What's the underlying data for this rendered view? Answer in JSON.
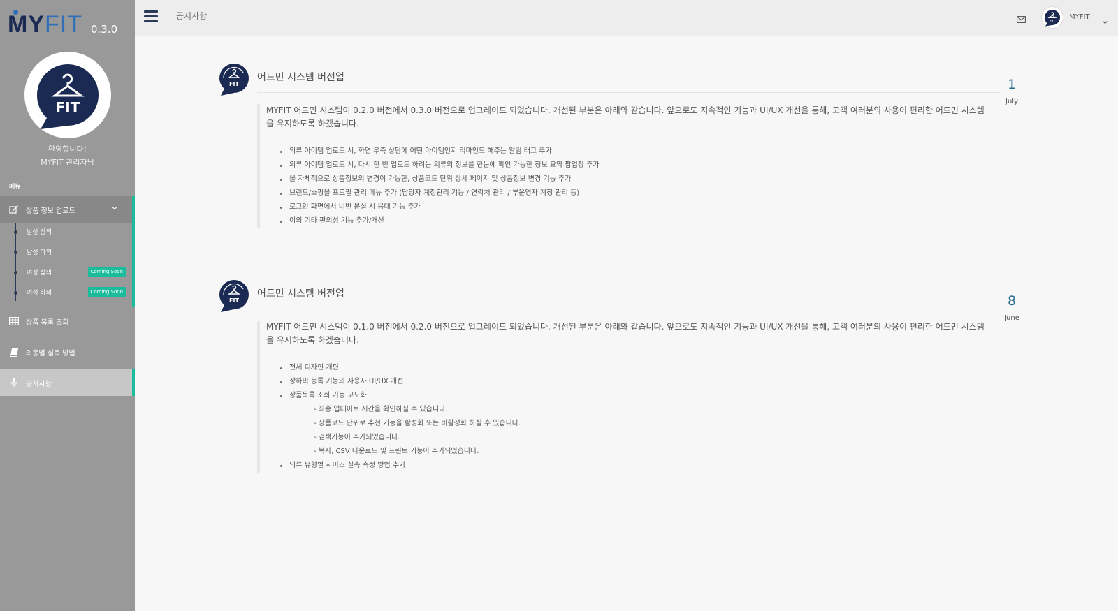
{
  "app": {
    "logo_left": "MY",
    "logo_right": "FIT",
    "version": "0.3.0"
  },
  "profile": {
    "welcome_line1": "환영합니다!",
    "welcome_line2": "MYFIT 관리자님",
    "logo_text": "FIT"
  },
  "sidebar": {
    "menu_label": "메뉴",
    "upload": {
      "label": "상품 정보 업로드",
      "icon": "edit-icon"
    },
    "sub_items": [
      {
        "label": "남성 상의",
        "badge": ""
      },
      {
        "label": "남성 하의",
        "badge": ""
      },
      {
        "label": "여성 상의",
        "badge": "Coming Soon"
      },
      {
        "label": "여성 하의",
        "badge": "Coming Soon"
      }
    ],
    "list": {
      "label": "상품 목록 조회",
      "icon": "table-icon"
    },
    "method": {
      "label": "의종별 실측 방법",
      "icon": "book-icon"
    },
    "notice": {
      "label": "공지사항",
      "icon": "microphone-icon"
    }
  },
  "topbar": {
    "title": "공지사항",
    "user": "MYFIT",
    "icons": [
      "menu-icon",
      "mail-icon",
      "chevron-down-icon"
    ]
  },
  "posts": [
    {
      "title": "어드민 시스템 버전업",
      "day": "1",
      "month": "July",
      "intro": "MYFIT 어드민 시스템이 0.2.0 버전에서 0.3.0 버전으로 업그레이드 되었습니다. 개선된 부분은 아래와 같습니다. 앞으로도 지속적인 기능과 UI/UX 개선을 통해, 고객 여러분의 사용이 편리한 어드민 시스템을 유지하도록 하겠습니다.",
      "items": [
        "의류 아이템 업로드 시, 화면 우측 상단에 어떤 아이템인지 리마인드 해주는 알림 태그 추가",
        "의류 아이템 업로드 시, 다시 한 번 업로드 하려는 의류의 정보를 한눈에 확인 가능한 정보 요약 팝업창 추가",
        "몰 자체적으로 상품정보의 변경이 가능한, 상품코드 단위 상세 페이지 및 상품정보 변경 기능 추가",
        "브랜드/쇼핑몰 프로필 관리 메뉴 추가 (담당자 계정관리 기능 / 연락처 관리 / 부운영자 계정 관리 등)",
        "로그인 화면에서 비번 분실 시 응대 기능 추가",
        "이외 기타 편의성 기능 추가/개선"
      ]
    },
    {
      "title": "어드민 시스템 버전업",
      "day": "8",
      "month": "June",
      "intro": "MYFIT 어드민 시스템이 0.1.0 버전에서 0.2.0 버전으로 업그레이드 되었습니다. 개선된 부분은 아래와 같습니다. 앞으로도 지속적인 기능과 UI/UX 개선을 통해, 고객 여러분의 사용이 편리한 어드민 시스템을 유지하도록 하겠습니다.",
      "items": [
        "전체 디자인 개편",
        "상하의 등록 기능의 사용자 UI/UX 개선",
        "상품목록 조회 기능 고도화"
      ],
      "sub_items": [
        "- 최종 업데이트 시간을 확인하실 수 있습니다.",
        "- 상품코드 단위로 추천 기능을 활성화 또는 비활성화 하실 수 있습니다.",
        "- 검색기능이 추가되었습니다.",
        "- 복사, CSV 다운로드 및 프린트 기능이 추가되었습니다."
      ],
      "last_item": "의류 유형별 사이즈 실측 측정 방법 추가"
    }
  ],
  "colors": {
    "sidebar": "#999999",
    "accent": "#1bbc9b",
    "navy": "#1b2a52",
    "date": "#2b6c8d"
  }
}
